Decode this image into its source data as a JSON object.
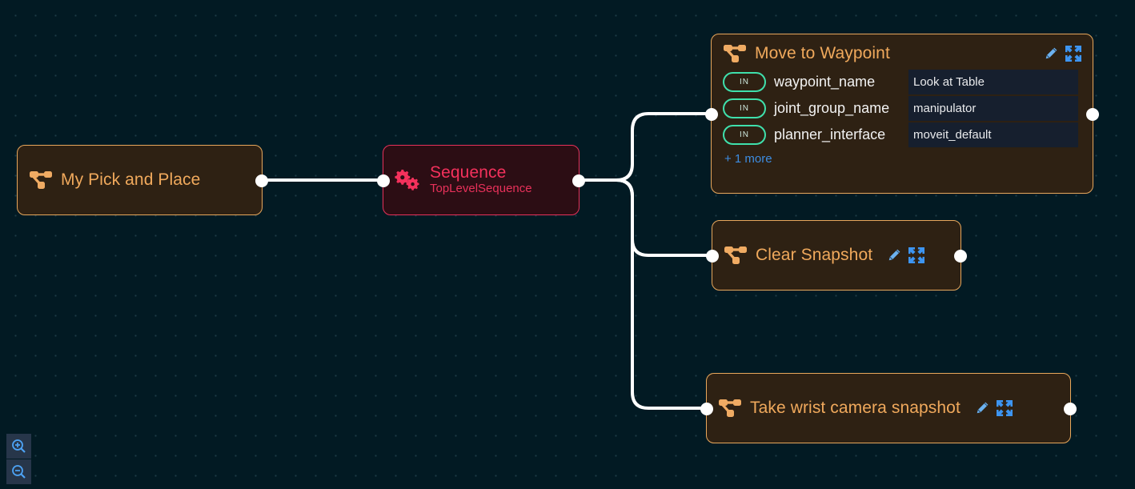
{
  "canvas": {
    "background_color": "#021a23",
    "dot_color": "#1d3c47",
    "edge_color": "#ffffff"
  },
  "nodes": [
    {
      "id": "root",
      "name": "My Pick and Place",
      "icon": "sitemap-icon",
      "kind": "action",
      "title_color": "#f0a95c",
      "border_color": "#e8a75c",
      "bg_color": "#2e2113"
    },
    {
      "id": "sequence",
      "name": "Sequence",
      "subtitle": "TopLevelSequence",
      "icon": "gears-icon",
      "kind": "control",
      "title_color": "#f4315c",
      "border_color": "#e8315a",
      "bg_color": "#2c0d14"
    },
    {
      "id": "move_to_waypoint",
      "name": "Move to Waypoint",
      "icon": "sitemap-icon",
      "kind": "action",
      "edit_icon": "pencil-icon",
      "expand_icon": "expand-arrows-icon",
      "more_label": "+ 1 more",
      "ports": [
        {
          "direction": "IN",
          "label": "waypoint_name",
          "value": "Look at Table"
        },
        {
          "direction": "IN",
          "label": "joint_group_name",
          "value": "manipulator"
        },
        {
          "direction": "IN",
          "label": "planner_interface",
          "value": "moveit_default"
        }
      ]
    },
    {
      "id": "clear_snapshot",
      "name": "Clear Snapshot",
      "icon": "sitemap-icon",
      "kind": "action",
      "edit_icon": "pencil-icon",
      "expand_icon": "expand-arrows-icon"
    },
    {
      "id": "take_wrist_camera_snapshot",
      "name": "Take wrist camera snapshot",
      "icon": "sitemap-icon",
      "kind": "action",
      "edit_icon": "pencil-icon",
      "expand_icon": "expand-arrows-icon"
    }
  ],
  "zoom_controls": {
    "zoom_in": {
      "label": "",
      "icon": "zoom-in-icon"
    },
    "zoom_out": {
      "label": "",
      "icon": "zoom-out-icon"
    }
  }
}
